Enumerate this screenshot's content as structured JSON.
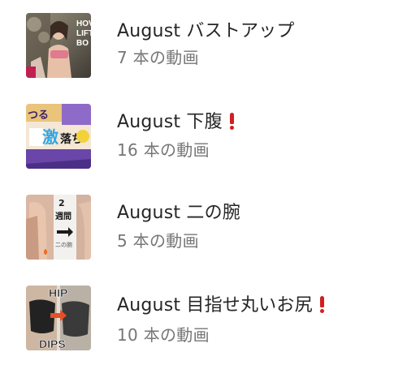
{
  "playlists": [
    {
      "title": "August バストアップ",
      "count": "7 本の動画",
      "thumbnail_text": [
        "HOV",
        "LIFT",
        "BO"
      ],
      "has_exclamation": false
    },
    {
      "title": "August 下腹",
      "count": "16 本の動画",
      "thumbnail_text": [
        "つる",
        "激",
        "落ち"
      ],
      "has_exclamation": true
    },
    {
      "title": "August 二の腕",
      "count": "5 本の動画",
      "thumbnail_text": [
        "2",
        "週間",
        "二の腕"
      ],
      "has_exclamation": false
    },
    {
      "title": "August 目指せ丸いお尻",
      "count": "10 本の動画",
      "thumbnail_text": [
        "HIP",
        "DIPS"
      ],
      "has_exclamation": true
    }
  ],
  "colors": {
    "title_text": "#262626",
    "count_text": "#767676",
    "exclamation": "#d21f1f"
  }
}
